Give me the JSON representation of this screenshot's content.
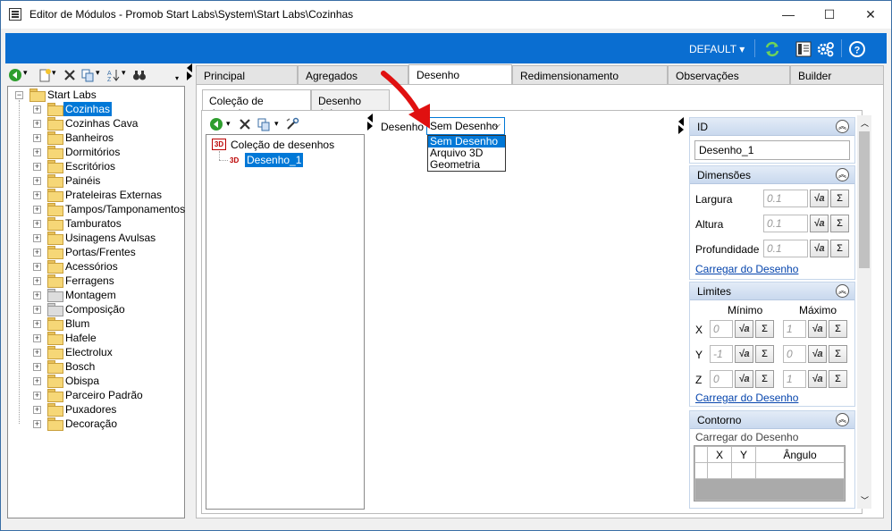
{
  "window": {
    "title": "Editor de Módulos - Promob Start Labs\\System\\Start Labs\\Cozinhas",
    "minimize": "—",
    "maximize": "☐",
    "close": "✕"
  },
  "bluebar": {
    "profile": "DEFAULT",
    "profile_chevron": "▾"
  },
  "tree": {
    "root": "Start Labs",
    "items": [
      "Cozinhas",
      "Cozinhas Cava",
      "Banheiros",
      "Dormitórios",
      "Escritórios",
      "Painéis",
      "Prateleiras Externas",
      "Tampos/Tamponamentos",
      "Tamburatos",
      "Usinagens Avulsas",
      "Portas/Frentes",
      "Acessórios",
      "Ferragens",
      "Montagem",
      "Composição",
      "Blum",
      "Hafele",
      "Electrolux",
      "Bosch",
      "Obispa",
      "Parceiro Padrão",
      "Puxadores",
      "Decoração"
    ],
    "selected": "Cozinhas"
  },
  "tabs": [
    "Principal",
    "Agregados",
    "Desenho",
    "Redimensionamento",
    "Observações",
    "Builder"
  ],
  "active_tab": "Desenho",
  "subtabs": [
    "Coleção de desenhos",
    "Desenho único"
  ],
  "collection": {
    "root": "Coleção de desenhos",
    "root_badge": "3D",
    "child": "Desenho_1",
    "child_badge": "3D"
  },
  "desenho": {
    "label": "Desenho",
    "selected": "Sem Desenho",
    "options": [
      "Sem Desenho",
      "Arquivo 3D",
      "Geometria"
    ]
  },
  "props": {
    "id_header": "ID",
    "id_value": "Desenho_1",
    "dimensoes_header": "Dimensões",
    "largura": "Largura",
    "altura": "Altura",
    "profundidade": "Profundidade",
    "dim_value": "0.1",
    "carregar": "Carregar do Desenho",
    "limites_header": "Limites",
    "minimo": "Mínimo",
    "maximo": "Máximo",
    "x": "X",
    "y": "Y",
    "z": "Z",
    "x_min": "0",
    "x_max": "1",
    "y_min": "-1",
    "y_max": "0",
    "z_min": "0",
    "z_max": "1",
    "contorno_header": "Contorno",
    "contorno_carregar": "Carregar do Desenho",
    "table_cols": [
      "X",
      "Y",
      "Ângulo"
    ]
  },
  "glyphs": {
    "sigma": "Σ",
    "sqrt": "√a",
    "collapse": "︽",
    "plus": "+",
    "minus": "−"
  },
  "colors": {
    "accent": "#0a6ed1",
    "selection": "#0078d7",
    "arrow": "#e01010"
  }
}
